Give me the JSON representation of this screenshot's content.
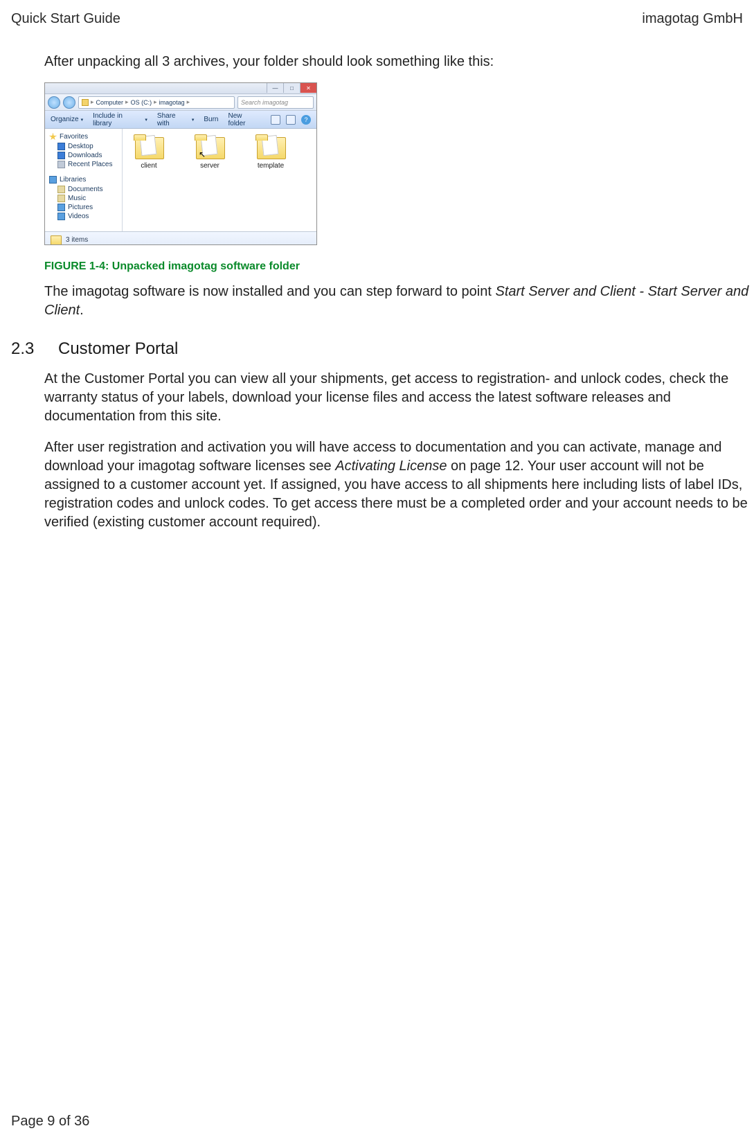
{
  "header": {
    "left": "Quick Start Guide",
    "right": "imagotag GmbH"
  },
  "intro": "After unpacking all 3 archives, your folder should look something like this:",
  "explorer": {
    "breadcrumb": {
      "c1": "Computer",
      "c2": "OS (C:)",
      "c3": "imagotag"
    },
    "search_placeholder": "Search imagotag",
    "toolbar": {
      "organize": "Organize",
      "include": "Include in library",
      "share": "Share with",
      "burn": "Burn",
      "newfolder": "New folder"
    },
    "sidebar": {
      "fav_header": "Favorites",
      "desktop": "Desktop",
      "downloads": "Downloads",
      "recent": "Recent Places",
      "lib_header": "Libraries",
      "documents": "Documents",
      "music": "Music",
      "pictures": "Pictures",
      "videos": "Videos"
    },
    "folders": [
      {
        "label": "client"
      },
      {
        "label": "server"
      },
      {
        "label": "template"
      }
    ],
    "status": "3 items"
  },
  "figure_caption": "FIGURE 1-4: Unpacked imagotag software folder",
  "para_after_figure_a": "The imagotag software is now installed and you can step forward to point ",
  "para_after_figure_b": "Start Server and Client - Start Server and Client",
  "para_after_figure_c": ".",
  "section": {
    "num": "2.3",
    "title": "Customer Portal"
  },
  "portal_p1": "At the Customer Portal you can view all your shipments, get access to registration- and unlock codes, check the warranty status of your labels, download your license files and access the latest software releases and documentation from this site.",
  "portal_p2_a": "After user registration and activation you will have access to documentation and you can activate, manage and download your imagotag software licenses see ",
  "portal_p2_b": "Activating License",
  "portal_p2_c": " on page 12. Your user account will not be assigned to a customer account yet. If assigned, you have access to all shipments here including lists of label IDs, registration codes and unlock codes. To get access there must be a completed order and your account needs to be verified (existing customer account required).",
  "footer": "Page 9 of 36"
}
